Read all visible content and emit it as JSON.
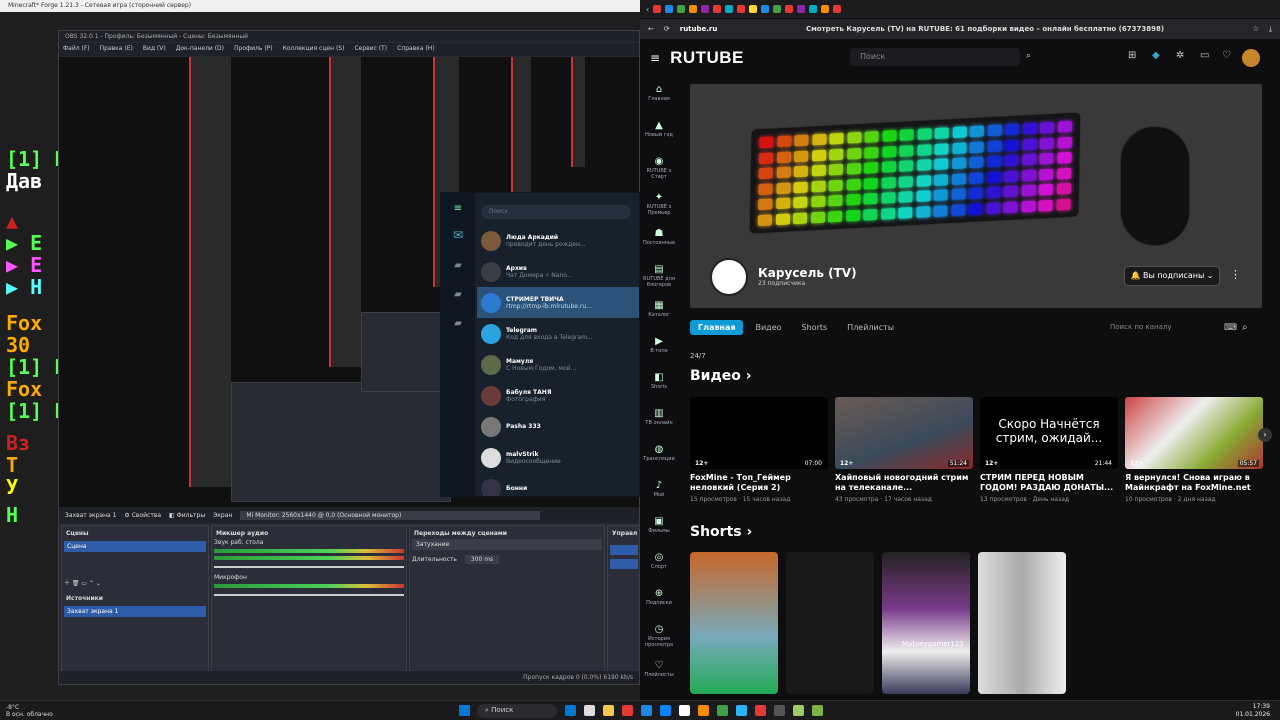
{
  "game": {
    "title": "Minecraft* Forge 1.21.3 - Сетевая игра (сторонний сервер)",
    "chat_lines": [
      "[1] Г",
      "Дав",
      "▶ Е",
      "▶ Е",
      "▶ Н",
      "Fox",
      "30",
      "[1] Г",
      "Fox",
      "[1] Г",
      "Вз",
      "Т",
      "У",
      "Н"
    ]
  },
  "obs": {
    "title": "OBS 32.0.1 - Профиль: Безымянный - Сцены: Безымянный",
    "menu": [
      "Файл (F)",
      "Правка (E)",
      "Вид (V)",
      "Док-панели (D)",
      "Профиль (P)",
      "Коллекция сцен (S)",
      "Сервис (T)",
      "Справка (H)"
    ],
    "source_bar": {
      "source": "Захват экрана 1",
      "properties": "Свойства",
      "filters": "Фильтры",
      "screen_label": "Экран",
      "screen_value": "Mi Monitor: 2560x1440 @ 0,0 (Основной монитор)"
    },
    "panels": {
      "scenes": {
        "title": "Сцены",
        "item": "Сцена"
      },
      "sources": {
        "title": "Источники",
        "item": "Захват экрана 1"
      },
      "mixer": {
        "title": "Микшер аудио",
        "ch1": "Звук раб. стола",
        "ch2": "Микрофон"
      },
      "transitions": {
        "title": "Переходы между сценами",
        "type": "Затухание",
        "duration_label": "Длительность",
        "duration": "300 ms"
      },
      "controls": {
        "title": "Управл"
      }
    },
    "status": "Пропуск кадров 0 (0.0%)   6190 kb/s"
  },
  "telegram": {
    "search": "Поиск",
    "chats": [
      {
        "name": "Люда Аркадий",
        "msg": "проводит день рожден...",
        "color": "#7a5a3a"
      },
      {
        "name": "Архив",
        "msg": "Чат Домера ⚡ Nano...",
        "color": "#3a3f45"
      },
      {
        "name": "СТРИМЕР ТВИЧА",
        "msg": "rtmp://rtmp-lb.mlrutube.ru...",
        "color": "#2b7bd1"
      },
      {
        "name": "Telegram",
        "msg": "Код для входа в Telegram...",
        "color": "#2aa3e0"
      },
      {
        "name": "Мамуля",
        "msg": "С Новым Годом, мой...",
        "color": "#5a6a4a"
      },
      {
        "name": "Бабуля ТАНЯ",
        "msg": "Фотография",
        "color": "#6a3a3a"
      },
      {
        "name": "Pasha 333",
        "msg": "",
        "color": "#777"
      },
      {
        "name": "malvStrik",
        "msg": "Видеосообщение",
        "color": "#ddd"
      },
      {
        "name": "Бонни",
        "msg": "",
        "color": "#334"
      }
    ]
  },
  "browser": {
    "url": "rutube.ru",
    "page_title": "Смотреть Карусель (TV) на RUTUBE: 61 подборки видео – онлайн бесплатно (67373898)",
    "tab_colors": [
      "#e53935",
      "#1e88e5",
      "#43a047",
      "#fb8c00",
      "#8e24aa",
      "#e53935",
      "#00acc1",
      "#e53935",
      "#fdd835",
      "#1e88e5",
      "#43a047",
      "#e53935",
      "#8e24aa",
      "#00acc1",
      "#fb8c00",
      "#e53935"
    ]
  },
  "rutube": {
    "logo": "RUTUBE",
    "search_placeholder": "Поиск",
    "nav": [
      {
        "icon": "⌂",
        "label": "Главная"
      },
      {
        "icon": "▲",
        "label": "Новый год"
      },
      {
        "icon": "◉",
        "label": "RUTUBE х Старт"
      },
      {
        "icon": "✦",
        "label": "RUTUBE х Премьер"
      },
      {
        "icon": "☗",
        "label": "Постоянные"
      },
      {
        "icon": "▤",
        "label": "RUTUBE для блогеров"
      },
      {
        "icon": "▦",
        "label": "Каталог"
      },
      {
        "icon": "▶",
        "label": "В топе"
      },
      {
        "icon": "◧",
        "label": "Shorts"
      },
      {
        "icon": "▥",
        "label": "ТВ онлайн"
      },
      {
        "icon": "◍",
        "label": "Трансляции"
      },
      {
        "icon": "♪",
        "label": "Мой"
      },
      {
        "icon": "▣",
        "label": "Фильмы"
      },
      {
        "icon": "◎",
        "label": "Спорт"
      },
      {
        "icon": "⊕",
        "label": "Подписки"
      },
      {
        "icon": "◷",
        "label": "История просмотра"
      },
      {
        "icon": "♡",
        "label": "Плейлисты"
      }
    ],
    "channel": {
      "name": "Карусель (TV)",
      "subs": "23 подписчика",
      "subscribe": "Вы подписаны"
    },
    "tabs": [
      "Главная",
      "Видео",
      "Shorts",
      "Плейлисты"
    ],
    "channel_search": "Поиск по каналу",
    "live_label": "24/7",
    "videos_heading": "Видео ›",
    "shorts_heading": "Shorts ›",
    "videos": [
      {
        "title": "FoxMine - Топ_Геймер неловкий (Серия 2)",
        "age": "12+",
        "duration": "07:00",
        "views": "15 просмотров",
        "when": "15 часов назад",
        "bg": "#000000"
      },
      {
        "title": "Хайповый новогодний стрим на телеканале...",
        "age": "12+",
        "duration": "51:24",
        "views": "43 просмотра",
        "when": "17 часов назад",
        "bg": "#5b4a44"
      },
      {
        "title": "СТРИМ ПЕРЕД НОВЫМ ГОДОМ! РАЗДАЮ ДОНАТЫ...",
        "age": "12+",
        "duration": "21:44",
        "views": "13 просмотров",
        "when": "День назад",
        "bg": "#000000",
        "overlay": "Скоро Начнётся стрим, ожидай..."
      },
      {
        "title": "Я вернулся! Снова играю в Майнкрафт на FoxMine.net",
        "age": "12+",
        "duration": "05:57",
        "views": "10 просмотров",
        "when": "2 дня назад",
        "bg": "#a33a3a"
      }
    ],
    "shorts_bg": [
      "#c8672a",
      "#181818",
      "#5a5a5a",
      "#e6e6e6"
    ],
    "short_overlay": "Matveygamer123"
  },
  "taskbar": {
    "weather": "-8°C",
    "weather_desc": "В осн. облачно",
    "search": "Поиск",
    "time": "17:39",
    "date": "01.01.2026",
    "icon_colors": [
      "#0078d4",
      "#ddd",
      "#f2c94c",
      "#e53935",
      "#1e88e5",
      "#0a84ff",
      "#fff",
      "#fb8c00",
      "#43a047",
      "#29b6f6",
      "#e53935",
      "#555",
      "#9ccc65",
      "#7cb342"
    ]
  }
}
